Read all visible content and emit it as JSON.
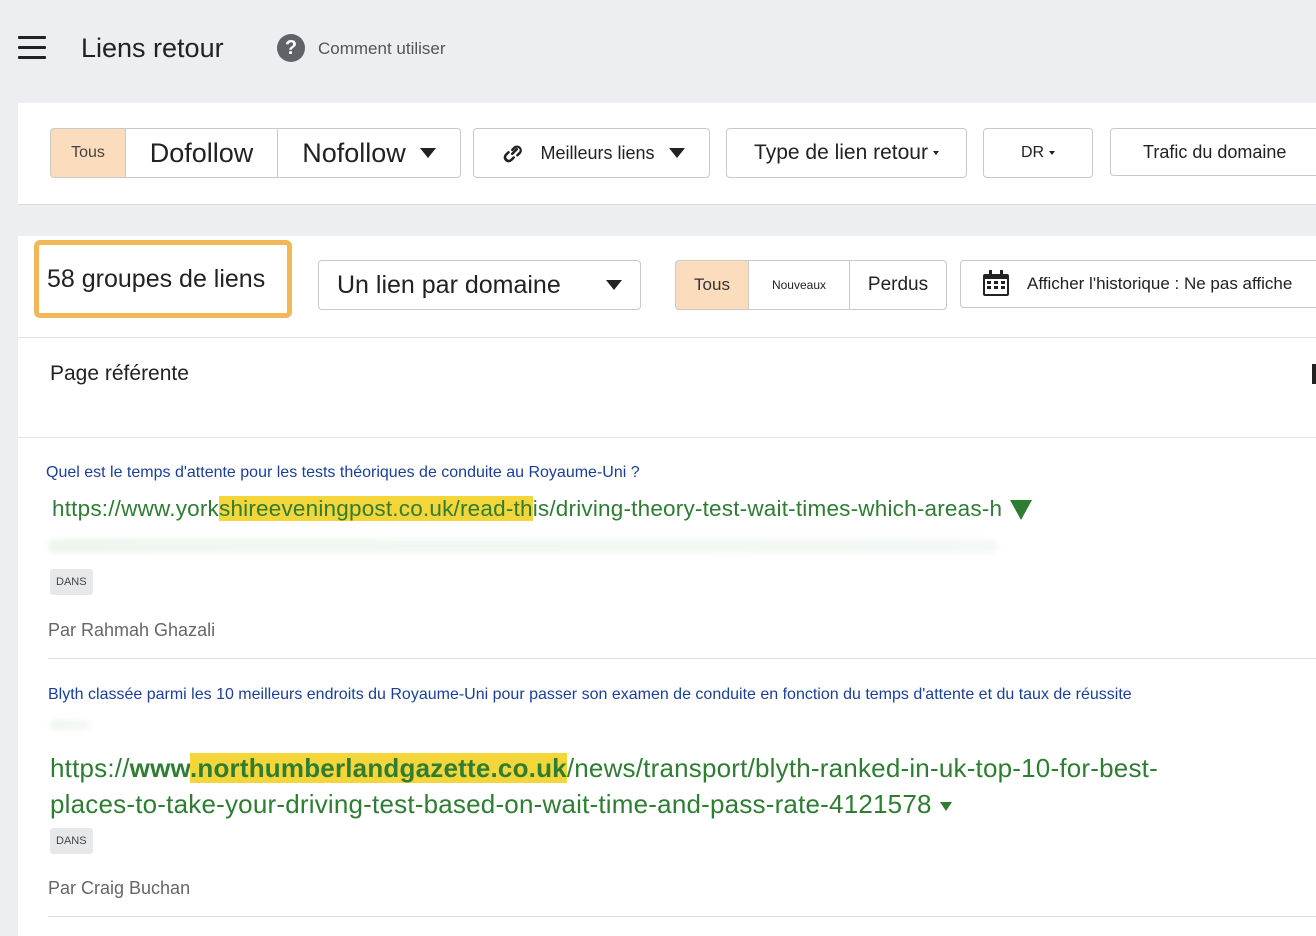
{
  "header": {
    "title": "Liens retour",
    "help_label": "Comment utiliser",
    "help_icon_glyph": "?"
  },
  "filters": {
    "link_type_tabs": [
      "Tous",
      "Dofollow",
      "Nofollow"
    ],
    "best_links": "Meilleurs liens",
    "backlink_type": "Type de lien retour",
    "dr": "DR",
    "domain_traffic": "Trafic du domaine"
  },
  "results": {
    "count_label": "58 groupes de liens",
    "grouping": "Un lien par domaine",
    "status_tabs": [
      "Tous",
      "Nouveaux",
      "Perdus"
    ],
    "history": "Afficher l'historique : Ne pas affiche",
    "column_header": "Page référente"
  },
  "entries": [
    {
      "title": "Quel est le temps d'attente pour les tests théoriques de conduite au Royaume-Uni ?",
      "url_pre": "https://www.york",
      "url_hl": "shireeveningpost.co.uk/read-th",
      "url_post": "is/driving-theory-test-wait-times-which-areas-h",
      "badge": "DANS",
      "author": "Par Rahmah Ghazali"
    },
    {
      "title": "Blyth classée parmi les 10 meilleurs endroits du Royaume-Uni pour passer son examen de conduite en fonction du temps d'attente et du taux de réussite",
      "url_pre": "https://",
      "url_bold_pre": "www",
      "url_hl": ".northumberlandgazette.co.uk",
      "url_line1_post": "/news/transport/blyth-ranked-in-uk-top-10-for-best-",
      "url_line2": "places-to-take-your-driving-test-based-on-wait-time-and-pass-rate-4121578",
      "badge": "DANS",
      "author": "Par Craig Buchan"
    }
  ],
  "colors": {
    "accent_orange": "#f2b857",
    "active_tab": "#fbdcbc",
    "highlight": "#f5d63a",
    "url_green": "#2e7d32",
    "title_blue": "#1a3f9b"
  }
}
